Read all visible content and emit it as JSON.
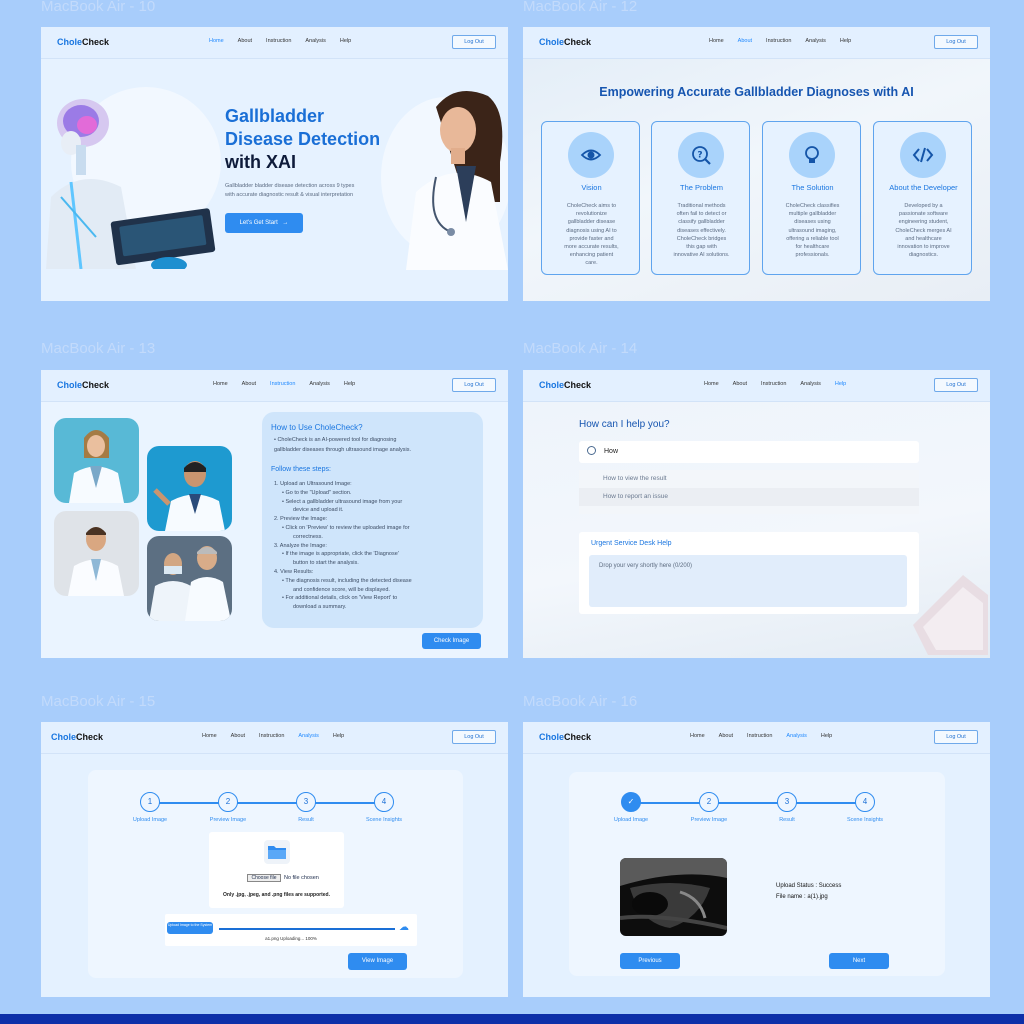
{
  "frame_labels": [
    "MacBook Air - 10",
    "MacBook Air - 12",
    "MacBook Air - 13",
    "MacBook Air - 14",
    "MacBook Air - 15",
    "MacBook Air - 16"
  ],
  "brand": {
    "part1": "Chole",
    "part2": "Check"
  },
  "nav": [
    "Home",
    "About",
    "Instruction",
    "Analysis",
    "Help"
  ],
  "logout_label": "Log Out",
  "colors": {
    "background": "#a8cdfb",
    "accent": "#2f8cf0",
    "frame": "#eef6ff",
    "bottom_bar": "#0d2fa8"
  },
  "home": {
    "title_line1": "Gallbladder",
    "title_line2": "Disease Detection",
    "title_line3": "with XAI",
    "subtitle_line1": "Gallbladder bladder disease detection across 9 types",
    "subtitle_line2": "with accurate diagnostic result & visual interpretation",
    "cta": "Let's Get Start",
    "cta_icon": "arrow-right-icon"
  },
  "about": {
    "heading": "Empowering Accurate Gallbladder Diagnoses with AI",
    "cards": [
      {
        "icon": "eye-icon",
        "title": "Vision",
        "lines": [
          "CholeCheck aims to",
          "revolutionize",
          "gallbladder disease",
          "diagnosis using AI to",
          "provide faster and",
          "more accurate results,",
          "enhancing patient",
          "care."
        ]
      },
      {
        "icon": "question-icon",
        "title": "The Problem",
        "lines": [
          "Traditional methods",
          "often fail to detect or",
          "classify gallbladder",
          "diseases effectively.",
          "CholeCheck bridges",
          "this gap with",
          "innovative AI solutions."
        ]
      },
      {
        "icon": "lightbulb-icon",
        "title": "The Solution",
        "lines": [
          "CholeCheck classifies",
          "multiple gallbladder",
          "diseases using",
          "ultrasound imaging,",
          "offering a reliable tool",
          "for healthcare",
          "professionals."
        ]
      },
      {
        "icon": "code-icon",
        "title": "About the Developer",
        "lines": [
          "Developed by a",
          "passionate software",
          "engineering student,",
          "CholeCheck merges AI",
          "and healthcare",
          "innovation to improve",
          "diagnostics."
        ]
      }
    ]
  },
  "instruction": {
    "heading": "How to Use CholeCheck?",
    "intro": [
      {
        "bullet": true,
        "text": "CholeCheck is an AI-powered tool for diagnosing"
      },
      {
        "bullet": false,
        "text": "gallbladder diseases through ultrasound image analysis."
      }
    ],
    "steps_heading": "Follow these steps:",
    "steps": [
      {
        "indent": 0,
        "text": "1. Upload an Ultrasound Image:"
      },
      {
        "indent": 1,
        "text": "Go to the \"Upload\" section."
      },
      {
        "indent": 1,
        "text": "Select a gallbladder ultrasound image from your"
      },
      {
        "indent": 2,
        "text": "device and upload it."
      },
      {
        "indent": 0,
        "text": "2. Preview the Image:"
      },
      {
        "indent": 1,
        "text": "Click on 'Preview' to review the uploaded image for"
      },
      {
        "indent": 2,
        "text": "correctness."
      },
      {
        "indent": 0,
        "text": "3. Analyze the Image:"
      },
      {
        "indent": 1,
        "text": "If the image is appropriate, click the 'Diagnose'"
      },
      {
        "indent": 2,
        "text": "button to start the analysis."
      },
      {
        "indent": 0,
        "text": "4. View Results:"
      },
      {
        "indent": 1,
        "text": "The diagnosis result, including the detected disease"
      },
      {
        "indent": 2,
        "text": "and confidence score, will be displayed."
      },
      {
        "indent": 1,
        "text": "For additional details, click on 'View Report' to"
      },
      {
        "indent": 2,
        "text": "download a summary."
      }
    ],
    "button": "Check Image"
  },
  "help": {
    "heading": "How can I help you?",
    "search_value": "How",
    "suggestions": [
      "How to view the result",
      "How to report an issue"
    ],
    "desk_heading": "Urgent Service Desk Help",
    "textarea_placeholder": "Drop your very shortly here (0/200)"
  },
  "stepper": [
    "Upload Image",
    "Preview Image",
    "Result",
    "Scene Insights"
  ],
  "analysis_upload": {
    "choose_file": "Choose file",
    "no_file": "No file chosen",
    "supported": "Only .jpg, .jpeg, and .png files are supported.",
    "upload_button": "Upload Image to the System",
    "progress_text": "a1.png Uploading... 100%",
    "progress": 1.0,
    "view_image": "View Image"
  },
  "analysis_result": {
    "status": "Upload Status : Success",
    "filename": "File name : a(1).jpg",
    "previous": "Previous",
    "next": "Next"
  }
}
